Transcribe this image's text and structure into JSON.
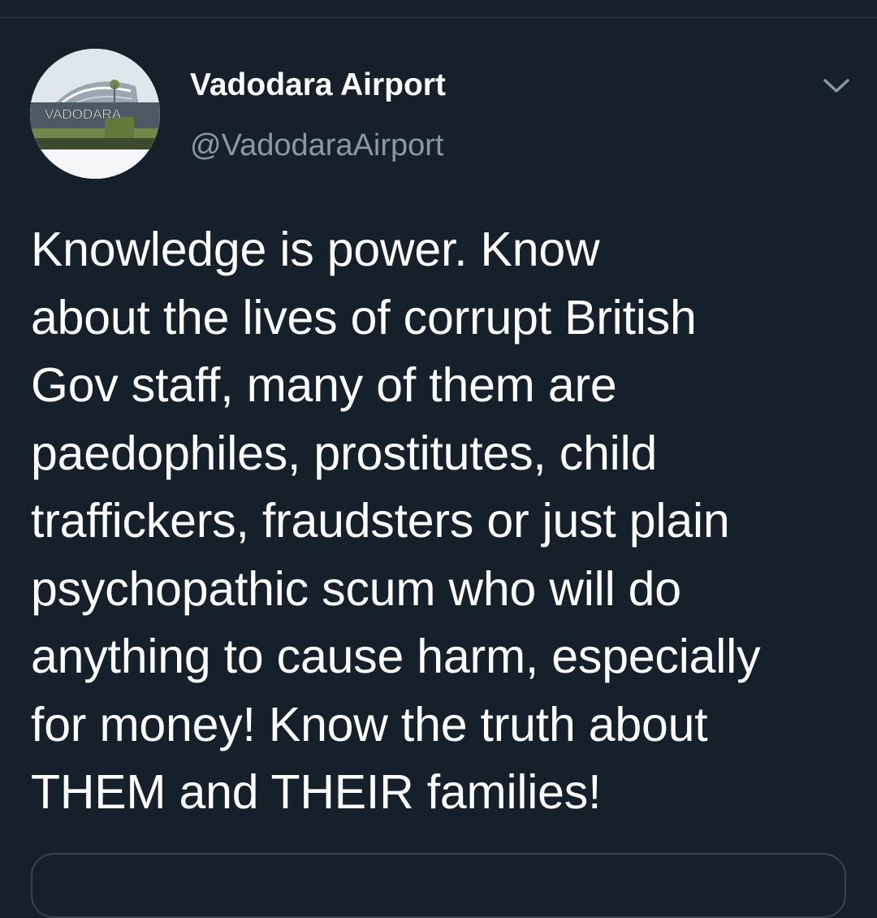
{
  "tweet": {
    "author": {
      "display_name": "Vadodara Airport",
      "handle": "@VadodaraAirport",
      "avatar_sign_text": "VADODARA"
    },
    "menu_icon": "chevron-down-icon",
    "text_lines": [
      "Knowledge is power. Know",
      "about the lives of corrupt British",
      "Gov staff, many of them are",
      "paedophiles, prostitutes, child",
      "traffickers, fraudsters or just plain",
      "psychopathic scum who will do",
      "anything to cause harm, especially",
      "for money! Know the truth about",
      "THEM and THEIR families!"
    ]
  },
  "colors": {
    "background": "#15202b",
    "primary_text": "#ffffff",
    "secondary_text": "#8899a6",
    "border": "#38444d"
  }
}
